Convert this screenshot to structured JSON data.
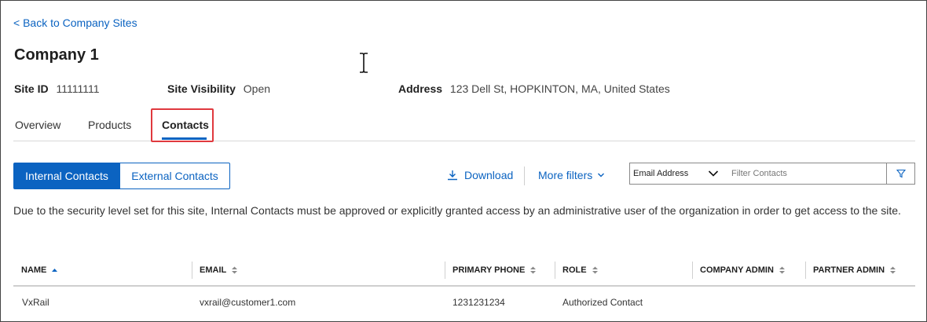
{
  "back_link": "< Back to Company Sites",
  "page_title": "Company 1",
  "meta": {
    "site_id_label": "Site ID",
    "site_id_value": "11111111",
    "visibility_label": "Site Visibility",
    "visibility_value": "Open",
    "address_label": "Address",
    "address_value": "123 Dell St, HOPKINTON, MA, United States"
  },
  "tabs": [
    {
      "label": "Overview"
    },
    {
      "label": "Products"
    },
    {
      "label": "Contacts",
      "active": true
    }
  ],
  "toggle": {
    "internal": "Internal Contacts",
    "external": "External Contacts"
  },
  "actions": {
    "download": "Download",
    "more_filters": "More filters"
  },
  "filter": {
    "select_value": "Email Address",
    "placeholder": "Filter Contacts"
  },
  "notice": "Due to the security level set for this site, Internal Contacts must be approved or explicitly granted access by an administrative user of the organization in order to get access to the site.",
  "table": {
    "columns": [
      "NAME",
      "EMAIL",
      "PRIMARY PHONE",
      "ROLE",
      "COMPANY ADMIN",
      "PARTNER ADMIN"
    ],
    "rows": [
      {
        "name": "VxRail",
        "email": "vxrail@customer1.com",
        "phone": "1231231234",
        "role": "Authorized Contact",
        "company_admin": "",
        "partner_admin": ""
      }
    ]
  },
  "colors": {
    "accent": "#0b63c1",
    "highlight": "#e0393e"
  }
}
